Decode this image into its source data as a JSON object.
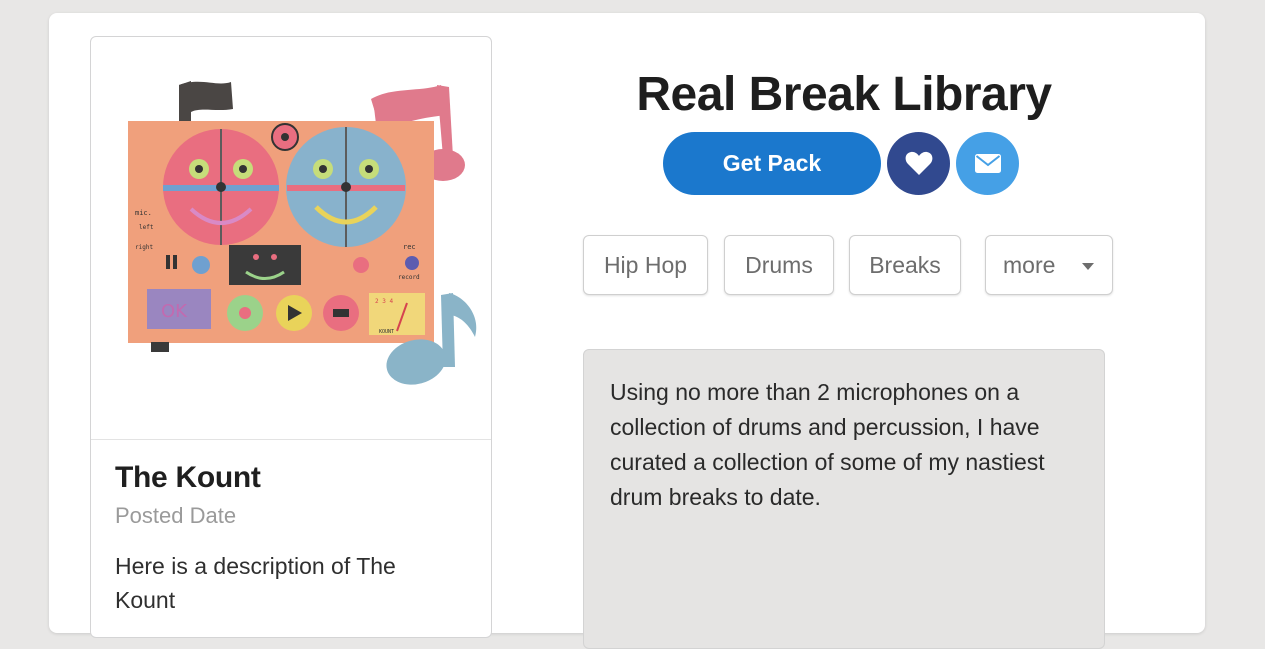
{
  "artist": {
    "name": "The Kount",
    "posted_date": "Posted Date",
    "description": "Here is a description of The Kount",
    "artwork_labels": {
      "mic": "mic.",
      "left": "left",
      "right": "right",
      "rec": "rec",
      "record": "record",
      "ok": "OK",
      "meter_brand": "KOUNT",
      "meter_scale": "2 3 4"
    }
  },
  "pack": {
    "title": "Real Break Library",
    "get_pack_label": "Get Pack",
    "like_icon": "heart-icon",
    "share_icon": "envelope-icon"
  },
  "tags": [
    "Hip Hop",
    "Drums",
    "Breaks"
  ],
  "more_dropdown": {
    "label": "more"
  },
  "description": "Using no more than 2 microphones on a collection of drums and percussion, I have curated a collection of some of my nastiest drum breaks to date.",
  "colors": {
    "primary": "#1b78cd",
    "like": "#31498f",
    "share": "#45a0e6",
    "background": "#e8e7e6"
  }
}
